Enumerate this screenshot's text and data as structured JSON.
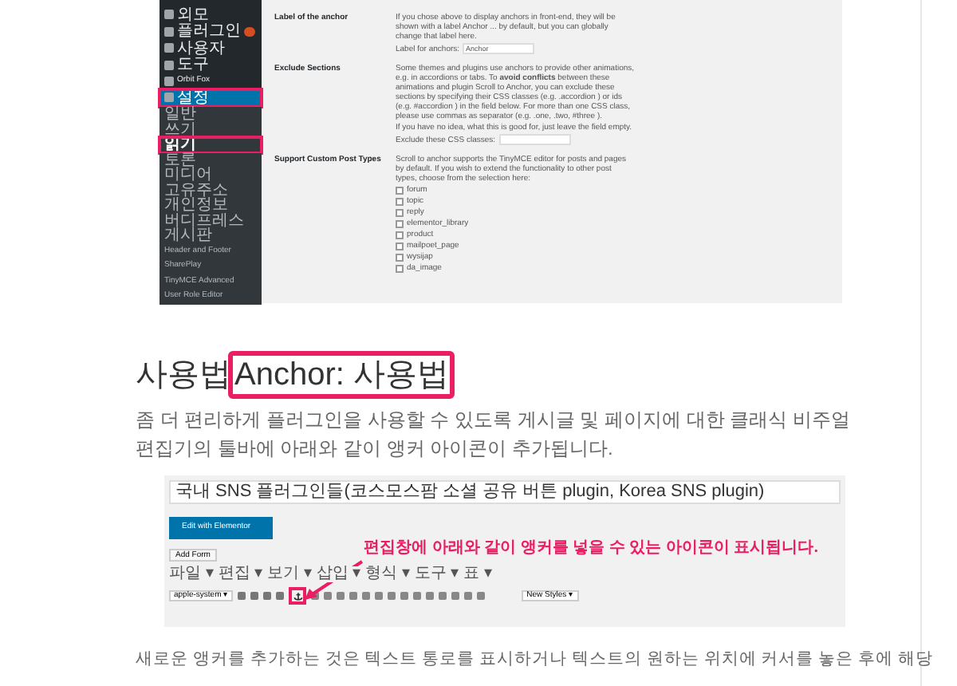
{
  "settings_screenshot": {
    "sidebar": [
      {
        "label": "외모",
        "kind": "menu",
        "selected": false,
        "highlighted": false,
        "badge": false
      },
      {
        "label": "플러그인",
        "kind": "menu",
        "selected": false,
        "highlighted": false,
        "badge": true
      },
      {
        "label": "사용자",
        "kind": "menu",
        "selected": false,
        "highlighted": false,
        "badge": false
      },
      {
        "label": "도구",
        "kind": "menu",
        "selected": false,
        "highlighted": false,
        "badge": false
      },
      {
        "label": "Orbit Fox",
        "kind": "menu",
        "selected": false,
        "highlighted": false,
        "badge": false
      },
      {
        "label": "설정",
        "kind": "menu",
        "selected": true,
        "highlighted": true,
        "badge": false
      },
      {
        "label": "일반",
        "kind": "submenu",
        "selected": false,
        "highlighted": false,
        "badge": false
      },
      {
        "label": "쓰기",
        "kind": "submenu",
        "selected": false,
        "highlighted": false,
        "badge": false
      },
      {
        "label": "읽기",
        "kind": "submenu",
        "selected": true,
        "highlighted": true,
        "badge": false
      },
      {
        "label": "토론",
        "kind": "submenu",
        "selected": false,
        "highlighted": false,
        "badge": false
      },
      {
        "label": "미디어",
        "kind": "submenu",
        "selected": false,
        "highlighted": false,
        "badge": false
      },
      {
        "label": "고유주소",
        "kind": "submenu",
        "selected": false,
        "highlighted": false,
        "badge": false
      },
      {
        "label": "개인정보",
        "kind": "submenu",
        "selected": false,
        "highlighted": false,
        "badge": false
      },
      {
        "label": "버디프레스",
        "kind": "submenu",
        "selected": false,
        "highlighted": false,
        "badge": false
      },
      {
        "label": "게시판",
        "kind": "submenu",
        "selected": false,
        "highlighted": false,
        "badge": false
      },
      {
        "label": "Header and Footer",
        "kind": "submenu",
        "selected": false,
        "highlighted": false,
        "badge": false
      },
      {
        "label": "SharePlay",
        "kind": "submenu",
        "selected": false,
        "highlighted": false,
        "badge": false
      },
      {
        "label": "TinyMCE Advanced",
        "kind": "submenu",
        "selected": false,
        "highlighted": false,
        "badge": false
      },
      {
        "label": "User Role Editor",
        "kind": "submenu",
        "selected": false,
        "highlighted": false,
        "badge": false
      }
    ],
    "rows": [
      {
        "label": "Label of the anchor",
        "description": "If you chose above to display anchors in front-end, they will be shown with a label Anchor ... by default, but you can globally change that label here.",
        "field": {
          "label": "Label for anchors:",
          "value": "Anchor"
        }
      },
      {
        "label": "Exclude Sections",
        "description": "Some themes and plugins use anchors to provide other animations, e.g. in accordions or tabs. To **avoid conflicts** between these animations and plugin Scroll to Anchor, you can exclude these sections by specifying their CSS classes (e.g. .accordion ) or ids (e.g. #accordion ) in the field below. For more than one CSS class, please use commas as separator (e.g. .one, .two, #three ).",
        "note": "If you have no idea, what this is good for, just leave the field empty.",
        "field": {
          "label": "Exclude these CSS classes:"
        }
      },
      {
        "label": "Support Custom Post Types",
        "description": "Scroll to anchor supports the TinyMCE editor for posts and pages by default. If you wish to extend the functionality to other post types, choose from the selection here:",
        "checkboxes": [
          {
            "label": "forum",
            "checked": false
          },
          {
            "label": "topic",
            "checked": false
          },
          {
            "label": "reply",
            "checked": false
          },
          {
            "label": "elementor_library",
            "checked": false
          },
          {
            "label": "product",
            "checked": false
          },
          {
            "label": "mailpoet_page",
            "checked": false
          },
          {
            "label": "wysijap",
            "checked": false
          },
          {
            "label": "da_image",
            "checked": false
          }
        ]
      }
    ]
  },
  "heading": {
    "text": "사용법",
    "highlight": "Anchor: 사용법"
  },
  "intro": "좀 더 편리하게 플러그인을 사용할 수 있도록 게시글 및 페이지에 대한 클래식 비주얼 편집기의 툴바에 아래와 같이 앵커 아이콘이 추가됩니다.",
  "editor_screenshot": {
    "title": "국내 SNS 플러그인들(코스모스팜 소셜 공유 버튼 plugin, Korea SNS plugin)",
    "elementor_button": "Edit with Elementor",
    "media_buttons": [
      "Add Form"
    ],
    "menubar": [
      "파일 ▾",
      "편집 ▾",
      "보기 ▾",
      "삽입 ▾",
      "형식 ▾",
      "도구 ▾",
      "표 ▾"
    ],
    "font_select": "apple-system ▾",
    "styles_select": "New Styles ▾",
    "annotation": "편집창에 아래와 같이 앵커를 넣을 수 있는 아이콘이 표시됩니다."
  },
  "body": "새로운 앵커를 추가하는 것은 텍스트 통로를 표시하거나 텍스트의 원하는 위치에 커서를 놓은 후에 해당"
}
